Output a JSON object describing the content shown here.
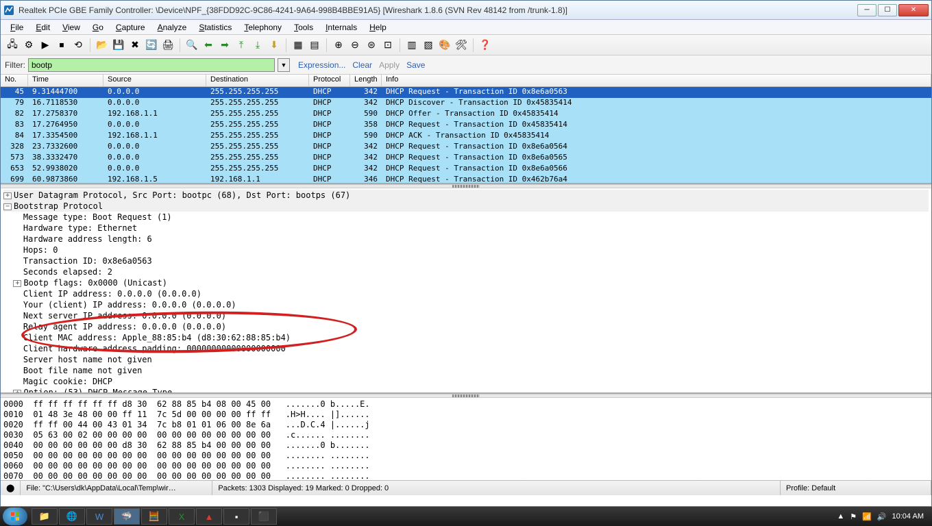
{
  "title": "Realtek PCIe GBE Family Controller: \\Device\\NPF_{38FDD92C-9C86-4241-9A64-998B4BBE91A5}   [Wireshark 1.8.6  (SVN Rev 48142 from /trunk-1.8)]",
  "menus": [
    "File",
    "Edit",
    "View",
    "Go",
    "Capture",
    "Analyze",
    "Statistics",
    "Telephony",
    "Tools",
    "Internals",
    "Help"
  ],
  "filter": {
    "label": "Filter:",
    "value": "bootp",
    "links": [
      "Expression...",
      "Clear",
      "Apply",
      "Save"
    ]
  },
  "columns": [
    "No.",
    "Time",
    "Source",
    "Destination",
    "Protocol",
    "Length",
    "Info"
  ],
  "packets": [
    {
      "no": "45",
      "time": "9.31444700",
      "src": "0.0.0.0",
      "dst": "255.255.255.255",
      "proto": "DHCP",
      "len": "342",
      "info": "DHCP Request  - Transaction ID 0x8e6a0563",
      "sel": true
    },
    {
      "no": "79",
      "time": "16.7118530",
      "src": "0.0.0.0",
      "dst": "255.255.255.255",
      "proto": "DHCP",
      "len": "342",
      "info": "DHCP Discover - Transaction ID 0x45835414"
    },
    {
      "no": "82",
      "time": "17.2758370",
      "src": "192.168.1.1",
      "dst": "255.255.255.255",
      "proto": "DHCP",
      "len": "590",
      "info": "DHCP Offer    - Transaction ID 0x45835414"
    },
    {
      "no": "83",
      "time": "17.2764950",
      "src": "0.0.0.0",
      "dst": "255.255.255.255",
      "proto": "DHCP",
      "len": "358",
      "info": "DHCP Request  - Transaction ID 0x45835414"
    },
    {
      "no": "84",
      "time": "17.3354500",
      "src": "192.168.1.1",
      "dst": "255.255.255.255",
      "proto": "DHCP",
      "len": "590",
      "info": "DHCP ACK      - Transaction ID 0x45835414"
    },
    {
      "no": "328",
      "time": "23.7332600",
      "src": "0.0.0.0",
      "dst": "255.255.255.255",
      "proto": "DHCP",
      "len": "342",
      "info": "DHCP Request  - Transaction ID 0x8e6a0564"
    },
    {
      "no": "573",
      "time": "38.3332470",
      "src": "0.0.0.0",
      "dst": "255.255.255.255",
      "proto": "DHCP",
      "len": "342",
      "info": "DHCP Request  - Transaction ID 0x8e6a0565"
    },
    {
      "no": "653",
      "time": "52.9938020",
      "src": "0.0.0.0",
      "dst": "255.255.255.255",
      "proto": "DHCP",
      "len": "342",
      "info": "DHCP Request  - Transaction ID 0x8e6a0566"
    },
    {
      "no": "699",
      "time": "60.9873860",
      "src": "192.168.1.5",
      "dst": "192.168.1.1",
      "proto": "DHCP",
      "len": "346",
      "info": "DHCP Request  - Transaction ID 0x462b76a4"
    }
  ],
  "details": {
    "udp": "User Datagram Protocol, Src Port: bootpc (68), Dst Port: bootps (67)",
    "bootp": "Bootstrap Protocol",
    "lines": [
      "Message type: Boot Request (1)",
      "Hardware type: Ethernet",
      "Hardware address length: 6",
      "Hops: 0",
      "Transaction ID: 0x8e6a0563",
      "Seconds elapsed: 2",
      "Bootp flags: 0x0000 (Unicast)",
      "Client IP address: 0.0.0.0 (0.0.0.0)",
      "Your (client) IP address: 0.0.0.0 (0.0.0.0)",
      "Next server IP address: 0.0.0.0 (0.0.0.0)",
      "Relay agent IP address: 0.0.0.0 (0.0.0.0)",
      "Client MAC address: Apple_88:85:b4 (d8:30:62:88:85:b4)",
      "Client hardware address padding: 00000000000000000000",
      "Server host name not given",
      "Boot file name not given",
      "Magic cookie: DHCP",
      "Option: (53) DHCP Message Type"
    ],
    "expandable_at": [
      6,
      16
    ]
  },
  "hex": [
    "0000  ff ff ff ff ff ff d8 30  62 88 85 b4 08 00 45 00   .......0 b.....E.",
    "0010  01 48 3e 48 00 00 ff 11  7c 5d 00 00 00 00 ff ff   .H>H.... |]......",
    "0020  ff ff 00 44 00 43 01 34  7c b8 01 01 06 00 8e 6a   ...D.C.4 |......j",
    "0030  05 63 00 02 00 00 00 00  00 00 00 00 00 00 00 00   .c...... ........",
    "0040  00 00 00 00 00 00 d8 30  62 88 85 b4 00 00 00 00   .......0 b.......",
    "0050  00 00 00 00 00 00 00 00  00 00 00 00 00 00 00 00   ........ ........",
    "0060  00 00 00 00 00 00 00 00  00 00 00 00 00 00 00 00   ........ ........",
    "0070  00 00 00 00 00 00 00 00  00 00 00 00 00 00 00 00   ........ ........"
  ],
  "status": {
    "file": "File: \"C:\\Users\\dk\\AppData\\Local\\Temp\\wir…",
    "packets": "Packets: 1303 Displayed: 19 Marked: 0 Dropped: 0",
    "profile": "Profile: Default"
  },
  "clock": "10:04 AM"
}
